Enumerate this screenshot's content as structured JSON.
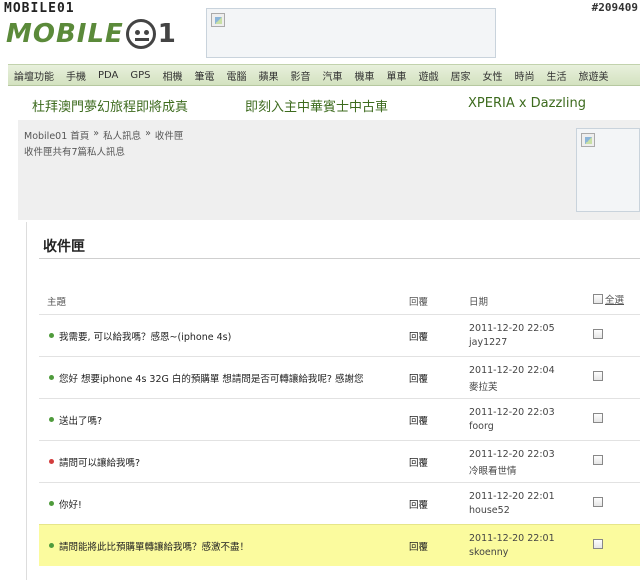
{
  "header": {
    "logo_small": "MOBILE01",
    "logo_text": "MOBILE",
    "logo_suffix": "1",
    "page_id": "#209409"
  },
  "nav": {
    "items": [
      "論壇功能",
      "手機",
      "PDA",
      "GPS",
      "相機",
      "筆電",
      "電腦",
      "蘋果",
      "影音",
      "汽車",
      "機車",
      "單車",
      "遊戲",
      "居家",
      "女性",
      "時尚",
      "生活",
      "旅遊美"
    ]
  },
  "promo": {
    "links": [
      "杜拜澳門夢幻旅程即將成真",
      "即刻入主中華賓士中古車",
      "XPERIA x Dazzling"
    ]
  },
  "breadcrumb": {
    "items": [
      "Mobile01 首頁",
      "私人訊息",
      "收件匣"
    ],
    "separator": "»"
  },
  "inbox_count": "收件匣共有7篇私人訊息",
  "inbox": {
    "title": "收件匣",
    "columns": {
      "subject": "主題",
      "reply": "回覆",
      "date": "日期",
      "select_all": "全選"
    },
    "rows": [
      {
        "subject": "我需要, 可以給我嗎？感恩~(iphone 4s)",
        "reply": "回覆",
        "date": "2011-12-20 22:05",
        "sender": "jay1227",
        "status": "read"
      },
      {
        "subject": "您好 想要iphone 4s 32G 白的預購單 想請問是否可轉讓給我呢? 感謝您",
        "reply": "回覆",
        "date": "2011-12-20 22:04",
        "sender": "麥拉芙",
        "status": "read"
      },
      {
        "subject": "送出了嗎?",
        "reply": "回覆",
        "date": "2011-12-20 22:03",
        "sender": "foorg",
        "status": "read"
      },
      {
        "subject": "請問可以讓給我嗎?",
        "reply": "回覆",
        "date": "2011-12-20 22:03",
        "sender": "冷眼看世情",
        "status": "unread"
      },
      {
        "subject": "你好!",
        "reply": "回覆",
        "date": "2011-12-20 22:01",
        "sender": "house52",
        "status": "read"
      },
      {
        "subject": "請問能將此比預購單轉讓給我嗎？感激不盡！",
        "reply": "回覆",
        "date": "2011-12-20 22:01",
        "sender": "skoenny",
        "status": "read",
        "highlight": true
      }
    ]
  },
  "colors": {
    "nav_bg": "#dde8cc",
    "promo_text": "#3d6b1e",
    "highlight": "#fbfb9e",
    "read_dot": "#4f9b3c",
    "unread_dot": "#d23c3c"
  }
}
